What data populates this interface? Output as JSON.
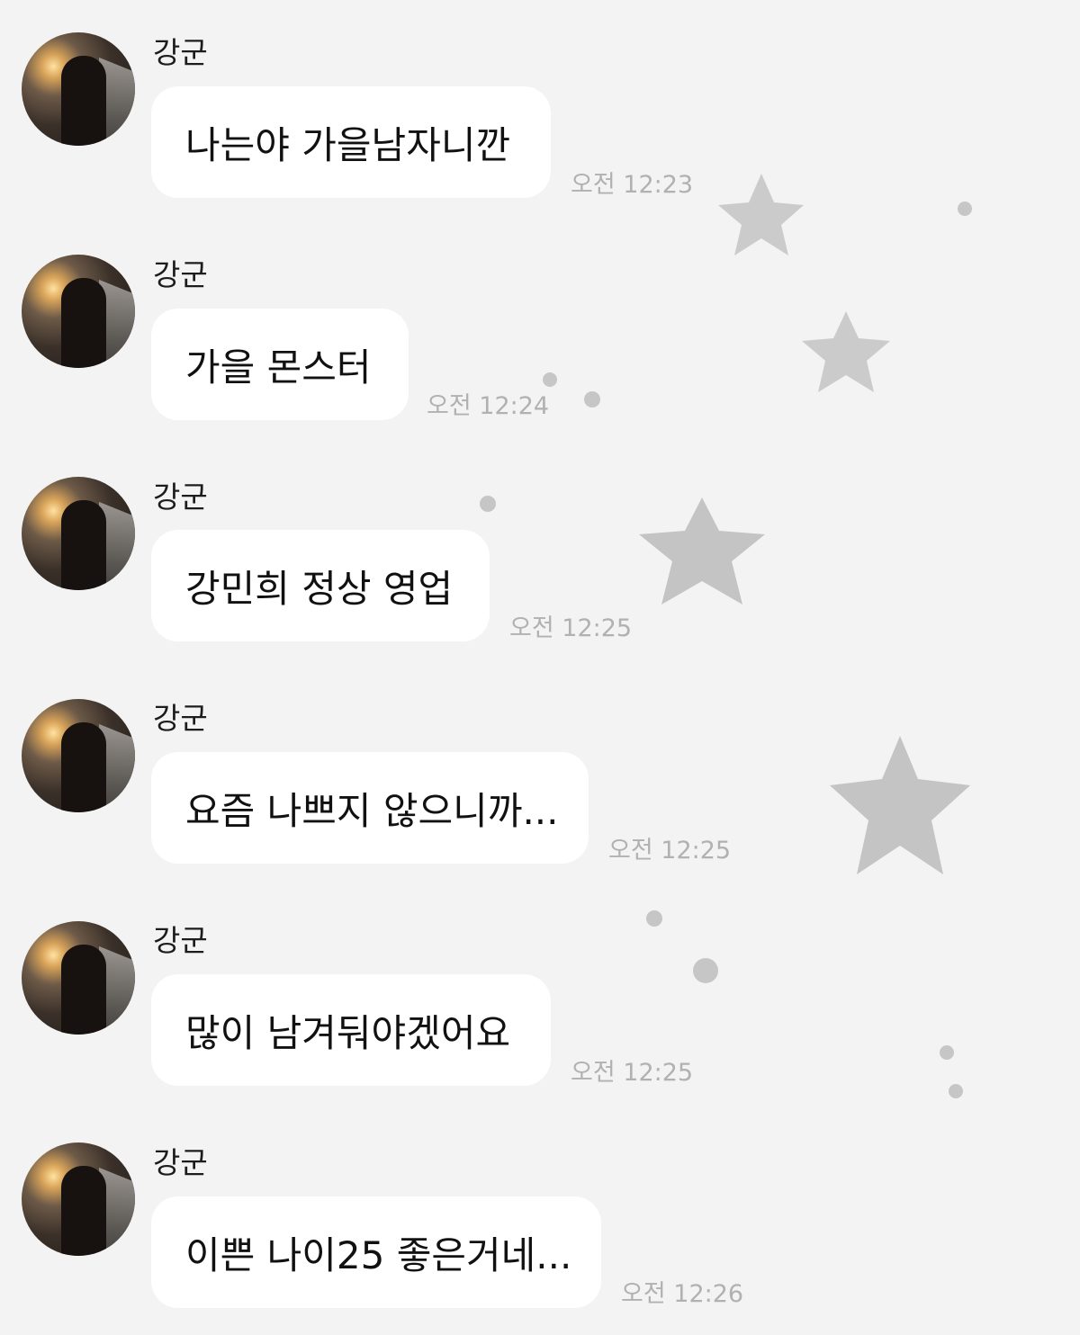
{
  "chat": {
    "messages": [
      {
        "sender": "강군",
        "text": "나는야 가을남자니깐",
        "time": "오전 12:23"
      },
      {
        "sender": "강군",
        "text": "가을 몬스터",
        "time": "오전 12:24"
      },
      {
        "sender": "강군",
        "text": "강민희 정상 영업",
        "time": "오전 12:25"
      },
      {
        "sender": "강군",
        "text": "요즘 나쁘지 않으니까...",
        "time": "오전 12:25"
      },
      {
        "sender": "강군",
        "text": "많이 남겨둬야겠어요",
        "time": "오전 12:25"
      },
      {
        "sender": "강군",
        "text": "이쁜 나이25 좋은거네...",
        "time": "오전 12:26"
      }
    ]
  },
  "colors": {
    "background": "#f3f3f3",
    "bubble": "#ffffff",
    "timestamp": "#b1b1b1",
    "star": "#c6c6c6"
  },
  "icons": {
    "avatar": "profile-photo-avatar",
    "decor": "star-icon"
  }
}
